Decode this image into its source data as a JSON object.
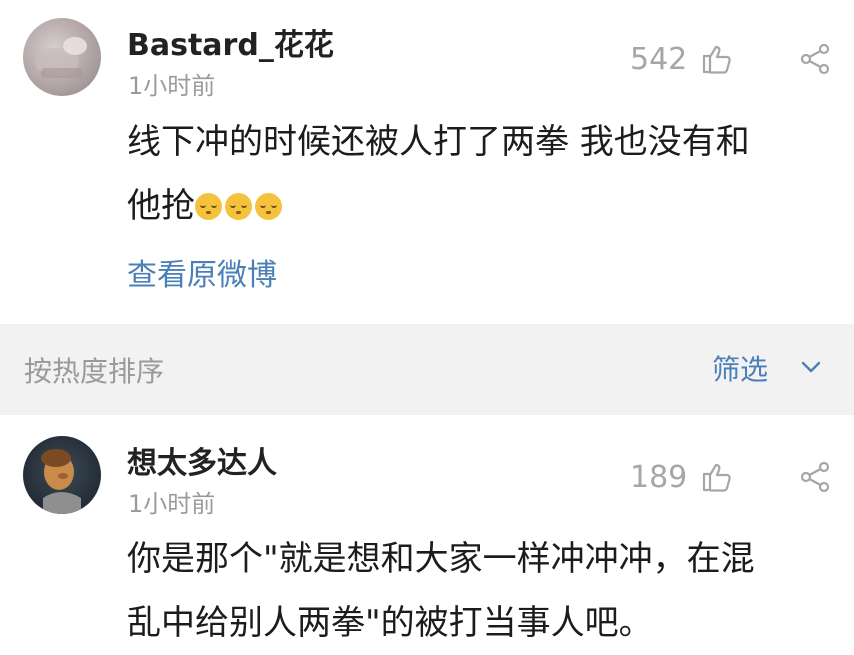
{
  "comments": [
    {
      "username": "Bastard_花花",
      "time": "1小时前",
      "likes": "542",
      "line1": "线下冲的时候还被人打了两拳 我也没有和",
      "line2": "他抢",
      "emoji": "flushed-face-emoji",
      "link": "查看原微博"
    },
    {
      "username": "想太多达人",
      "time": "1小时前",
      "likes": "189",
      "line1": "你是那个\"就是想和大家一样冲冲冲，在混",
      "line2": "乱中给别人两拳\"的被打当事人吧。"
    }
  ],
  "sortbar": {
    "label": "按热度排序",
    "filter_label": "筛选"
  },
  "icons": {
    "like": "thumbs-up-icon",
    "share": "share-icon",
    "dropdown": "chevron-down-icon"
  },
  "colors": {
    "link": "#4a7fb8",
    "muted": "#9b9b9b",
    "sortbar_bg": "#f2f2f2"
  }
}
